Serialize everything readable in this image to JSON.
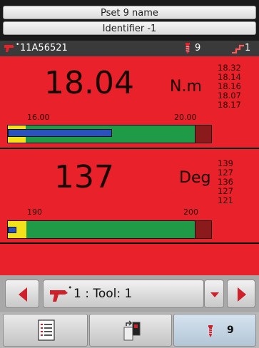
{
  "header": {
    "pset_name": "Pset 9 name",
    "identifier": "Identifier -1"
  },
  "status": {
    "tool_id": "11A56521",
    "screw_count": "9",
    "stage_count": "1"
  },
  "torque": {
    "value": "18.04",
    "unit": "N.m",
    "min_label": "16.00",
    "max_label": "20.00",
    "history": [
      "18.32",
      "18.14",
      "18.16",
      "18.07",
      "18.17"
    ],
    "min": 16.0,
    "max": 20.0,
    "current": 18.04
  },
  "angle": {
    "value": "137",
    "unit": "Deg",
    "min_label": "190",
    "max_label": "200",
    "history": [
      "139",
      "127",
      "136",
      "127",
      "121"
    ],
    "min": 190,
    "max": 200,
    "current": 137
  },
  "nav": {
    "tool_label": "1 : Tool: 1"
  },
  "tabs": {
    "screw_tab_count": "9"
  },
  "colors": {
    "panel": "#e8212a",
    "ok": "#1f9a46",
    "low": "#f3e21a",
    "high": "#8b1a1c",
    "value": "#2a52be"
  },
  "icons": [
    "tool-gun-icon",
    "screw-icon",
    "stair-icon",
    "left-arrow-icon",
    "right-arrow-icon",
    "dropdown-icon",
    "list-icon",
    "transfer-icon"
  ]
}
